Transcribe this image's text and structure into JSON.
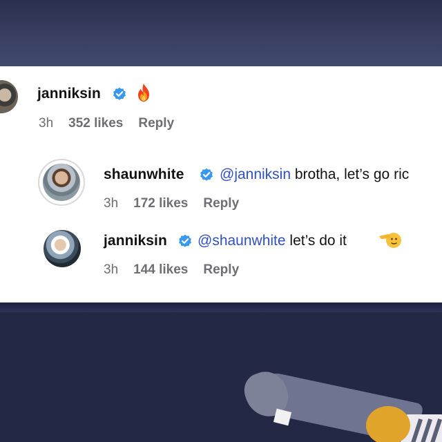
{
  "comments": [
    {
      "username": "janniksin",
      "text": "",
      "emoji": "fire-emoji",
      "time": "3h",
      "likes": "352 likes",
      "reply_label": "Reply"
    },
    {
      "username": "shaunwhite",
      "mention": "@janniksin",
      "text": " brotha, let’s go ric",
      "time": "3h",
      "likes": "172 likes",
      "reply_label": "Reply"
    },
    {
      "username": "janniksin",
      "mention": "@shaunwhite",
      "text": " let’s do it",
      "emoji": "salute-emoji",
      "time": "3h",
      "likes": "144 likes",
      "reply_label": "Reply"
    }
  ],
  "colors": {
    "verified_badge": "#3897f0",
    "mention": "#2f4fc4",
    "meta_text": "#6e6e73",
    "username": "#121212"
  },
  "icons": {
    "verified": "verified-badge-icon",
    "fire": "fire-emoji-icon",
    "salute": "saluting-face-emoji-icon"
  }
}
